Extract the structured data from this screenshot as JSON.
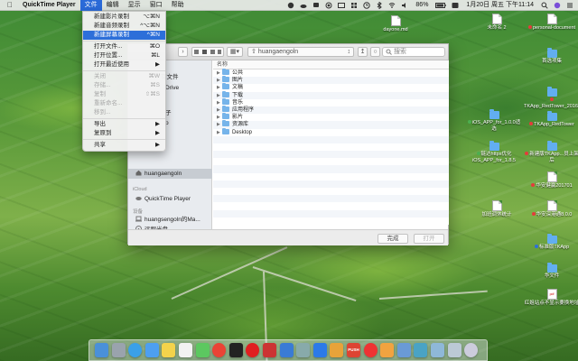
{
  "menubar": {
    "app_name": "QuickTime Player",
    "menus": [
      "文件",
      "编辑",
      "显示",
      "窗口",
      "帮助"
    ],
    "clock": "1月20日 周五 下午11:14",
    "battery": "86%"
  },
  "file_menu": {
    "items": [
      {
        "label": "新建影片录制",
        "shortcut": "⌥⌘N",
        "state": "normal"
      },
      {
        "label": "新建音频录制",
        "shortcut": "^⌥⌘N",
        "state": "normal"
      },
      {
        "label": "新建屏幕录制",
        "shortcut": "^⌘N",
        "state": "highlight"
      },
      {
        "sep": true
      },
      {
        "label": "打开文件...",
        "shortcut": "⌘O",
        "state": "normal"
      },
      {
        "label": "打开位置...",
        "shortcut": "⌘L",
        "state": "normal"
      },
      {
        "label": "打开最近使用",
        "shortcut": "▶",
        "state": "normal"
      },
      {
        "sep": true
      },
      {
        "label": "关闭",
        "shortcut": "⌘W",
        "state": "disabled"
      },
      {
        "label": "存储...",
        "shortcut": "⌘S",
        "state": "disabled"
      },
      {
        "label": "复制",
        "shortcut": "⇧⌘S",
        "state": "disabled"
      },
      {
        "label": "重新命名...",
        "shortcut": "",
        "state": "disabled"
      },
      {
        "label": "移到...",
        "shortcut": "",
        "state": "disabled"
      },
      {
        "sep": true
      },
      {
        "label": "导出",
        "shortcut": "▶",
        "state": "normal"
      },
      {
        "label": "复原到",
        "shortcut": "▶",
        "state": "normal"
      },
      {
        "sep": true
      },
      {
        "label": "共享",
        "shortcut": "▶",
        "state": "normal"
      }
    ]
  },
  "dialog": {
    "path": "huangaengoln",
    "search_placeholder": "搜索",
    "column_header": "名称",
    "sidebar": {
      "partial": [
        {
          "label": "有文件"
        },
        {
          "label": "Drive"
        },
        {
          "label": "子"
        },
        {
          "label": "p"
        }
      ],
      "user_home": "huangaengoln",
      "icloud_section": "iCloud",
      "icloud_item": "QuickTime Player",
      "devices_section": "设备",
      "device_mac": "huangsengoln的Ma...",
      "device_remote": "远程光盘"
    },
    "files": [
      "公共",
      "图片",
      "文稿",
      "下载",
      "音乐",
      "应用程序",
      "影片",
      "资源库",
      "Desktop"
    ],
    "done_button": "完成",
    "open_button": "打开"
  },
  "desktop": {
    "icons": [
      {
        "label": "dayone.md",
        "kind": "doc"
      },
      {
        "label": "未命名 2",
        "kind": "doc"
      },
      {
        "label": "personal-document",
        "kind": "doc",
        "tag": "#e53b3b"
      },
      {
        "label": "首选项集",
        "kind": "folder"
      },
      {
        "label": "TKApp_RedTower_20161031",
        "kind": "folder",
        "tag": "#e53b3b"
      },
      {
        "label": "iOS_APP_for_1.0.0适选",
        "kind": "folder",
        "tag": "#4caf50"
      },
      {
        "label": "TKApp_RedTower",
        "kind": "folder",
        "tag": "#e53b3b"
      },
      {
        "label": "链达https优化iOS_APP_for_1.8.5",
        "kind": "folder",
        "tag": "#4caf50"
      },
      {
        "label": "新建版TKApp...员上架后",
        "kind": "folder",
        "tag": "#e53b3b"
      },
      {
        "label": "华安健赢201701",
        "kind": "doc",
        "tag": "#e53b3b"
      },
      {
        "label": "加班调休统计",
        "kind": "doc"
      },
      {
        "label": "华安深港通8.0.0",
        "kind": "doc",
        "tag": "#e53b3b"
      },
      {
        "label": "标准版TKApp",
        "kind": "folder",
        "tag": "#2d6fd9"
      },
      {
        "label": "华文件",
        "kind": "folder"
      },
      {
        "label": "红姐站点不显示要换地址",
        "kind": "pdf"
      }
    ]
  },
  "dock": {
    "apps": [
      "finder-app",
      "launchpad-app",
      "safari-app",
      "mail-app",
      "notes-app",
      "calendar-app",
      "messages-app",
      "chrome-app",
      "terminal-app",
      "qq-app",
      "netease-app",
      "xcode-app",
      "simulator-app",
      "appstore-app",
      "photos-app",
      "push-app",
      "git-app",
      "pages-app",
      "preview-app",
      "photo-app",
      "downloads-folder",
      "documents-folder",
      "trash-app"
    ],
    "push_label": "PUSH"
  }
}
